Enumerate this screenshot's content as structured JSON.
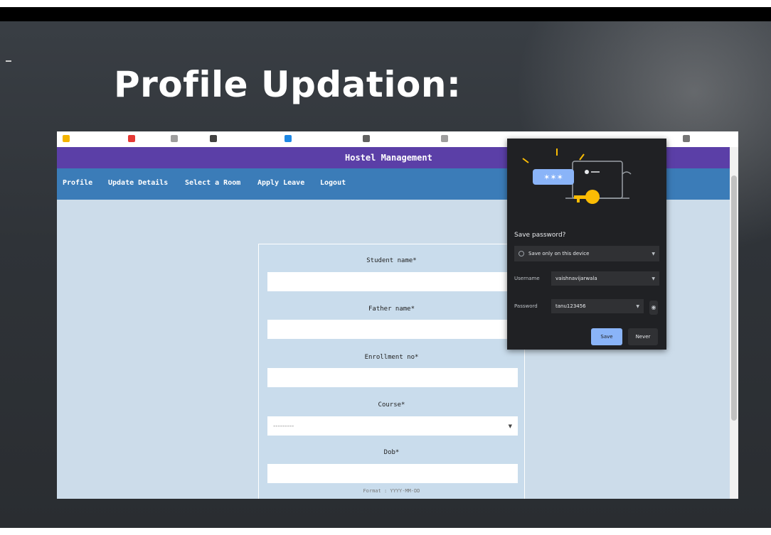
{
  "slide": {
    "title": "Profile Updation:"
  },
  "app": {
    "title": "Hostel Management",
    "nav": [
      "Profile",
      "Update Details",
      "Select a Room",
      "Apply Leave",
      "Logout"
    ]
  },
  "form": {
    "fields": [
      {
        "label": "Student name*",
        "value": ""
      },
      {
        "label": "Father name*",
        "value": ""
      },
      {
        "label": "Enrollment no*",
        "value": ""
      }
    ],
    "course": {
      "label": "Course*",
      "selected": "---------"
    },
    "dob": {
      "label": "Dob*",
      "value": "",
      "hint": "Format : YYYY-MM-DD"
    }
  },
  "password_popup": {
    "title": "Save password?",
    "storage_option": "Save only on this device",
    "username_label": "Username",
    "username_value": "vaishnavijarwala",
    "password_label": "Password",
    "password_value": "tanu123456",
    "save_label": "Save",
    "never_label": "Never"
  },
  "colors": {
    "header": "#5b3fa7",
    "navbar": "#3b7cb8",
    "page_bg": "#ccdcea",
    "popup_bg": "#202124",
    "accent_blue": "#8ab4f8",
    "key_yellow": "#fbbc04"
  }
}
